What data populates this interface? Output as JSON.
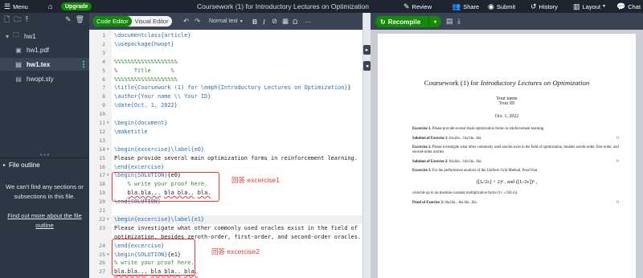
{
  "topbar": {
    "menu_label": "Menu",
    "upgrade_label": "Upgrade",
    "project_title": "Coursework (1) for Introductory Lectures on Optimization",
    "review_label": "Review",
    "share_label": "Share",
    "submit_label": "Submit",
    "history_label": "History",
    "layout_label": "Layout",
    "chat_label": "Chat"
  },
  "file_tree": {
    "folder": "hw1",
    "files": [
      {
        "name": "hw1.pdf",
        "icon": "image-file-icon"
      },
      {
        "name": "hw1.tex",
        "icon": "text-file-icon"
      },
      {
        "name": "hwopt.sty",
        "icon": "text-file-icon"
      }
    ]
  },
  "outline": {
    "title": "File outline",
    "message": "We can't find any sections or subsections in this file.",
    "link": "Find out more about the file outline"
  },
  "editor_toolbar": {
    "code_editor": "Code Editor",
    "visual_editor": "Visual Editor",
    "text_style": "Normal text"
  },
  "code": {
    "lines": [
      {
        "n": "1",
        "text": "\\documentclass{article}"
      },
      {
        "n": "2",
        "text": "\\usepackage{hwopt}"
      },
      {
        "n": "3",
        "text": ""
      },
      {
        "n": "4",
        "text": "%%%%%%%%%%%%%%%%%%%"
      },
      {
        "n": "5",
        "text": "%     Title      %"
      },
      {
        "n": "6",
        "text": "%%%%%%%%%%%%%%%%%%%"
      },
      {
        "n": "7",
        "text": "\\title{Coursework (1) for \\emph{Introductory Lectures on Optimization}}"
      },
      {
        "n": "8",
        "text": "\\author{Your name \\\\ Your ID}"
      },
      {
        "n": "9",
        "text": "\\date{Oct. 1, 2022}"
      },
      {
        "n": "10",
        "text": ""
      },
      {
        "n": "11",
        "text": "\\begin{document}"
      },
      {
        "n": "12",
        "text": "\\maketitle"
      },
      {
        "n": "13",
        "text": ""
      },
      {
        "n": "14",
        "text": "\\begin{excercise}\\label{e0}"
      },
      {
        "n": "15",
        "text": "Please provide several main optimization forms in reinforcement learning."
      },
      {
        "n": "16",
        "text": "\\end{excercise}"
      },
      {
        "n": "17",
        "text": "\\begin{SOLUTION}{e0}"
      },
      {
        "n": "18",
        "text": "    % write your proof here."
      },
      {
        "n": "19",
        "text": "    bla.bla... bla bla.. bla."
      },
      {
        "n": "20",
        "text": "\\end{SOLUTION}"
      },
      {
        "n": "21",
        "text": ""
      },
      {
        "n": "22",
        "text": "\\begin{excercise}\\label{e1}"
      },
      {
        "n": "23",
        "text": "Please investigate what other commonly used oracles exist in the field of"
      },
      {
        "n": "",
        "text": "optimization, besides zeroth-order, first-order, and second-order oracles."
      },
      {
        "n": "24",
        "text": "\\end{excercise}"
      },
      {
        "n": "25",
        "text": "\\begin{SOLUTION}{e1}"
      },
      {
        "n": "26",
        "text": "% write your proof here."
      },
      {
        "n": "27",
        "text": "bla.bla... bla bla.. bla."
      },
      {
        "n": "28",
        "text": "\\end{SOLUTION}"
      }
    ]
  },
  "annotations": {
    "a1": "回答 excercise1",
    "a2": "回答 excercise2"
  },
  "pdf": {
    "recompile_label": "Recompile",
    "title_plain": "Coursework (1) for ",
    "title_emph": "Introductory Lectures on Optimization",
    "author_name": "Your name",
    "author_id": "Your ID",
    "date": "Oct. 1, 2022",
    "ex1_head": "Excercise 1.",
    "ex1_text": "Please provide several main optimization forms in reinforcement learning.",
    "sol1_head": "Solution of Exercise 1:",
    "sol1_text": "bla.bla... bla bla.. bla.",
    "ex2_head": "Excercise 2.",
    "ex2_text": "Please investigate what other commonly used oracles exist in the field of optimization, besides zeroth-order, first-order, and second-order oracles.",
    "sol2_head": "Solution of Exercise 2:",
    "sol2_text": "bla.bla... bla bla.. bla.",
    "ex3_head": "Excercise 3.",
    "ex3_text": "For the performance analysis of the Uniform Grid Method, Proof that",
    "formula": "(⌊L/2ε⌋ + 2)ⁿ ,  and  (⌊L/2ε⌋)ⁿ ,",
    "ex3_tail": "coincide up to an absolute constant multiplicative factor if ε ≤ O(L/n).",
    "proof3_head": "Proof of Exercise 3:",
    "proof3_text": "bla.bla... bla bla.. bla.",
    "qed": "□"
  },
  "colors": {
    "accent_green": "#138a07",
    "annotation_red": "#e23b3b",
    "topbar": "#1e2530",
    "sidebar": "#2c3645"
  }
}
